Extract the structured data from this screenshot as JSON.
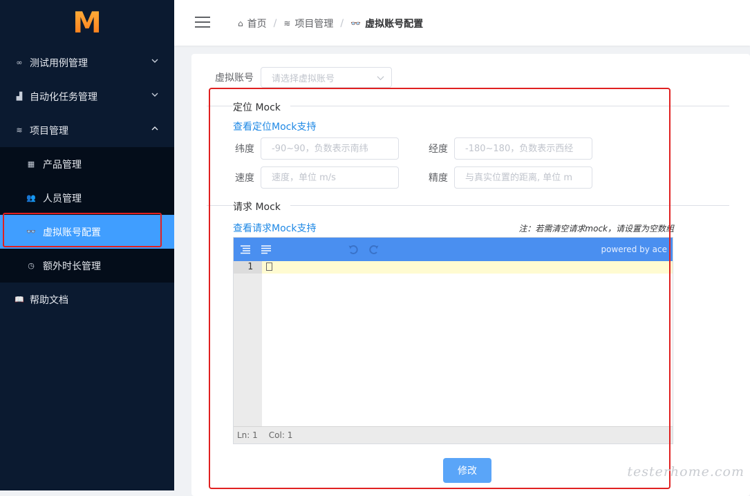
{
  "logo": "M",
  "sidebar": {
    "items": [
      {
        "label": "测试用例管理",
        "icon": "link-icon",
        "glyph": "∞",
        "expanded": false
      },
      {
        "label": "自动化任务管理",
        "icon": "bar-chart-icon",
        "glyph": "▟",
        "expanded": false
      },
      {
        "label": "项目管理",
        "icon": "layers-icon",
        "glyph": "≋",
        "expanded": true
      }
    ],
    "submenu": [
      {
        "label": "产品管理",
        "icon": "grid-icon",
        "glyph": "▦"
      },
      {
        "label": "人员管理",
        "icon": "users-icon",
        "glyph": "👥"
      },
      {
        "label": "虚拟账号配置",
        "icon": "glasses-icon",
        "glyph": "👓",
        "active": true
      },
      {
        "label": "额外时长管理",
        "icon": "clock-icon",
        "glyph": "◷"
      }
    ],
    "bottom": {
      "label": "帮助文档",
      "icon": "book-icon",
      "glyph": "📖"
    }
  },
  "breadcrumb": [
    {
      "label": "首页",
      "icon": "home-icon"
    },
    {
      "label": "项目管理",
      "icon": "layers-icon"
    },
    {
      "label": "虚拟账号配置",
      "icon": "glasses-icon"
    }
  ],
  "form": {
    "account_label": "虚拟账号",
    "account_placeholder": "请选择虚拟账号",
    "location_section": "定位 Mock",
    "location_link": "查看定位Mock支持",
    "latitude_label": "纬度",
    "latitude_placeholder": "-90~90，负数表示南纬",
    "longitude_label": "经度",
    "longitude_placeholder": "-180~180，负数表示西经",
    "speed_label": "速度",
    "speed_placeholder": "速度，单位 m/s",
    "accuracy_label": "精度",
    "accuracy_placeholder": "与真实位置的距离, 单位 m",
    "request_section": "请求 Mock",
    "request_link": "查看请求Mock支持",
    "note": "注：若需清空请求mock，请设置为空数组",
    "submit_label": "修改"
  },
  "editor": {
    "powered_by": "powered by ace",
    "line_numbers": [
      "1"
    ],
    "status_ln": "Ln: 1",
    "status_col": "Col: 1"
  },
  "colors": {
    "sidebar_bg": "#0b1a30",
    "active_item": "#409eff",
    "editor_toolbar": "#4a8ff0",
    "highlight_border": "#e02020",
    "link": "#1e88e5"
  },
  "watermark": "testerhome.com"
}
